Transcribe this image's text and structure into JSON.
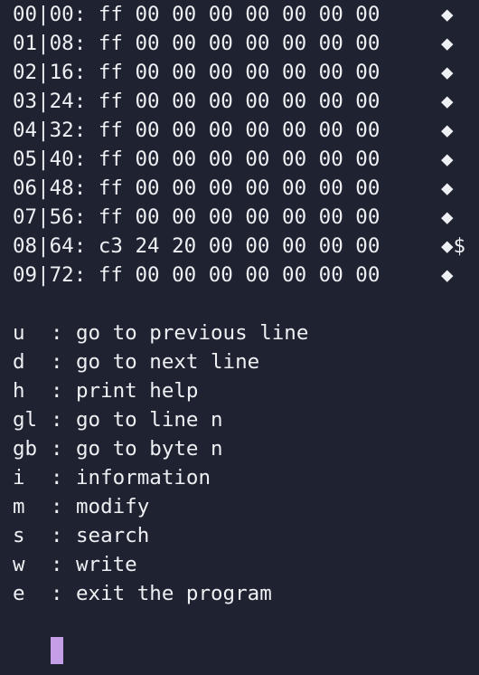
{
  "hex_rows": [
    {
      "addr": "00|00:",
      "bytes": "ff 00 00 00 00 00 00 00",
      "ascii": "◆"
    },
    {
      "addr": "01|08:",
      "bytes": "ff 00 00 00 00 00 00 00",
      "ascii": "◆"
    },
    {
      "addr": "02|16:",
      "bytes": "ff 00 00 00 00 00 00 00",
      "ascii": "◆"
    },
    {
      "addr": "03|24:",
      "bytes": "ff 00 00 00 00 00 00 00",
      "ascii": "◆"
    },
    {
      "addr": "04|32:",
      "bytes": "ff 00 00 00 00 00 00 00",
      "ascii": "◆"
    },
    {
      "addr": "05|40:",
      "bytes": "ff 00 00 00 00 00 00 00",
      "ascii": "◆"
    },
    {
      "addr": "06|48:",
      "bytes": "ff 00 00 00 00 00 00 00",
      "ascii": "◆"
    },
    {
      "addr": "07|56:",
      "bytes": "ff 00 00 00 00 00 00 00",
      "ascii": "◆"
    },
    {
      "addr": "08|64:",
      "bytes": "c3 24 20 00 00 00 00 00",
      "ascii": "◆$"
    },
    {
      "addr": "09|72:",
      "bytes": "ff 00 00 00 00 00 00 00",
      "ascii": "◆"
    }
  ],
  "help": [
    {
      "key": "u",
      "sep": ":",
      "desc": "go to previous line"
    },
    {
      "key": "d",
      "sep": ":",
      "desc": "go to next line"
    },
    {
      "key": "h",
      "sep": ":",
      "desc": "print help"
    },
    {
      "key": "gl",
      "sep": ":",
      "desc": "go to line n"
    },
    {
      "key": "gb",
      "sep": ":",
      "desc": "go to byte n"
    },
    {
      "key": "i",
      "sep": ":",
      "desc": "information"
    },
    {
      "key": "m",
      "sep": ":",
      "desc": "modify"
    },
    {
      "key": "s",
      "sep": ":",
      "desc": "search"
    },
    {
      "key": "w",
      "sep": ":",
      "desc": "write"
    },
    {
      "key": "e",
      "sep": ":",
      "desc": "exit the program"
    }
  ],
  "prompt": ">>",
  "colors": {
    "background": "#1f2230",
    "foreground": "#eef0f4",
    "cursor": "#c49fe8"
  }
}
